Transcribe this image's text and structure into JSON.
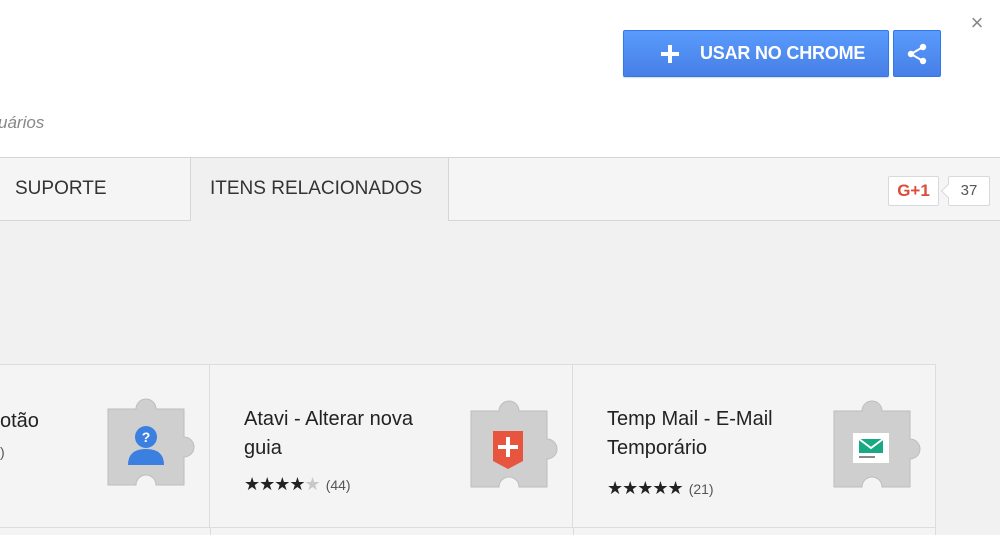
{
  "header": {
    "use_button_label": "USAR NO CHROME",
    "users_text": "uários",
    "close_glyph": "×"
  },
  "tabs": [
    {
      "label": "SUPORTE"
    },
    {
      "label": "ITENS RELACIONADOS",
      "active": true
    }
  ],
  "gplus": {
    "label": "G+1",
    "count": "37"
  },
  "cards": [
    {
      "title_line1": "otão",
      "title_line2": "",
      "rating_count": ")",
      "icon": "user-question-icon"
    },
    {
      "title_line1": "Atavi - Alterar nova",
      "title_line2": "guia",
      "stars": "★★★★",
      "stars_off": "★",
      "rating_count": "(44)",
      "icon": "atavi-plus-icon"
    },
    {
      "title_line1": "Temp Mail - E-Mail",
      "title_line2": "Temporário",
      "stars": "★★★★★",
      "stars_off": "",
      "rating_count": "(21)",
      "icon": "mail-icon"
    }
  ],
  "colors": {
    "accent": "#4d90fe",
    "gplus": "#dd4b39",
    "atavi": "#e8553e",
    "mail": "#17a884",
    "user": "#3b7fe0"
  }
}
